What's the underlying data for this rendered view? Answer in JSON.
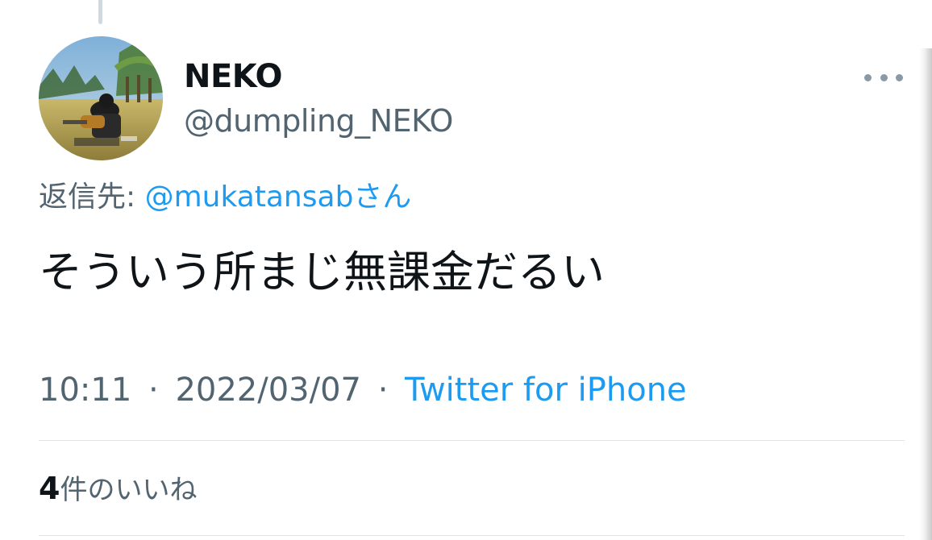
{
  "tweet": {
    "author": {
      "display_name": "NEKO",
      "username": "@dumpling_NEKO",
      "avatar_icon": "avatar-game-character-icon"
    },
    "more_icon": "more-horizontal-icon",
    "reply_to": {
      "prefix": "返信先:",
      "handle": "@mukatansab",
      "suffix": "さん"
    },
    "text": "そういう所まじ無課金だるい",
    "meta": {
      "time": "10:11",
      "separator": "·",
      "date": "2022/03/07",
      "source": "Twitter for iPhone"
    },
    "likes": {
      "count": "4",
      "label": "件のいいね"
    }
  },
  "colors": {
    "accent": "#1d9bf0",
    "text_primary": "#0f1419",
    "text_secondary": "#536471",
    "divider": "#dfe3e6"
  }
}
